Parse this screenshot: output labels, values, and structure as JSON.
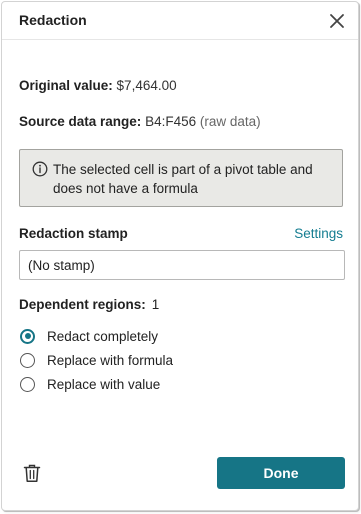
{
  "dialog": {
    "title": "Redaction"
  },
  "original_value": {
    "label": "Original value:",
    "value": "$7,464.00"
  },
  "source_range": {
    "label": "Source data range:",
    "value": "B4:F456",
    "note": "(raw data)"
  },
  "notice": {
    "text": "The selected cell is part of a pivot table and does not have a formula"
  },
  "stamp": {
    "label": "Redaction stamp",
    "settings_label": "Settings",
    "placeholder": "(No stamp)"
  },
  "dependent_regions": {
    "label": "Dependent regions:",
    "count": "1"
  },
  "options": [
    {
      "label": "Redact completely",
      "selected": true
    },
    {
      "label": "Replace with formula",
      "selected": false
    },
    {
      "label": "Replace with value",
      "selected": false
    }
  ],
  "footer": {
    "done_label": "Done"
  },
  "colors": {
    "accent": "#167586",
    "notice_bg": "#e9e9e6",
    "link": "#147d91"
  },
  "icons": {
    "close": "close-icon",
    "info": "info-icon",
    "trash": "trash-icon"
  }
}
